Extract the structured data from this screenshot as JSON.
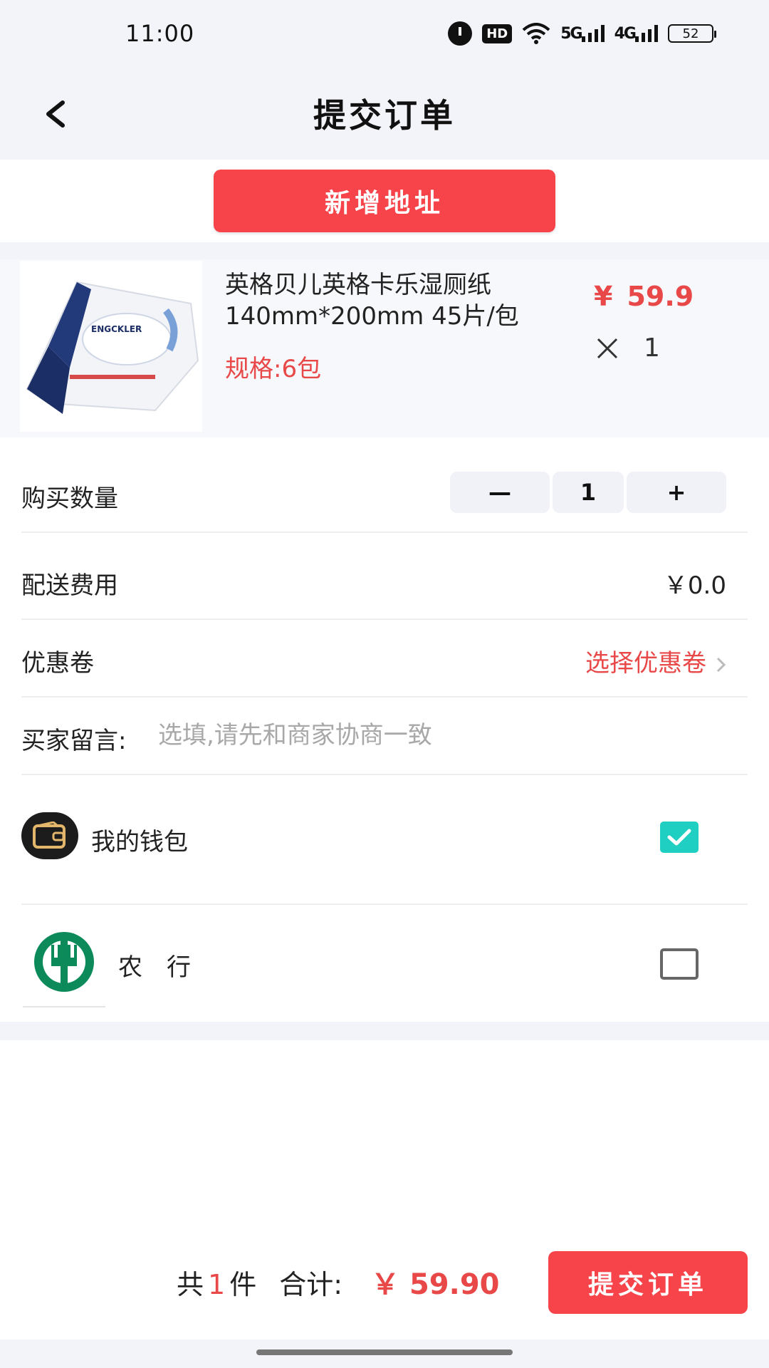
{
  "status_bar": {
    "time": "11:00",
    "hd_label": "HD",
    "net_5g": "5G",
    "net_4g": "4G",
    "battery": "52"
  },
  "header": {
    "title": "提交订单",
    "back_icon": "chevron-left-icon"
  },
  "address": {
    "add_button_label": "新增地址"
  },
  "product": {
    "image_icon": "wet-wipes-package-image",
    "brand_text": "ENGCKLER",
    "name": "英格贝儿英格卡乐湿厕纸140mm*200mm 45片/包",
    "spec": "规格:6包",
    "currency": "¥",
    "price": "59.9",
    "quantity": "1"
  },
  "rows": {
    "quantity_label": "购买数量",
    "stepper_minus": "—",
    "stepper_value": "1",
    "stepper_plus": "+",
    "delivery_label": "配送费用",
    "delivery_value": "￥0.0",
    "coupon_label": "优惠卷",
    "coupon_value": "选择优惠卷",
    "message_label": "买家留言:",
    "message_placeholder": "选填,请先和商家协商一致",
    "message_value": ""
  },
  "payment": {
    "wallet_label": "我的钱包",
    "wallet_checked": true,
    "bank_label": "农　行",
    "bank_checked": false
  },
  "footer": {
    "count_prefix": "共",
    "count": "1",
    "count_suffix": "件",
    "total_label": "合计:",
    "total_amount": "￥ 59.90",
    "submit_label": "提交订单"
  },
  "colors": {
    "accent_red": "#f7434a",
    "price_red": "#e94848",
    "check_teal": "#1fcfc1",
    "abc_green": "#0c8a5a",
    "background_gray": "#f3f4f9"
  }
}
